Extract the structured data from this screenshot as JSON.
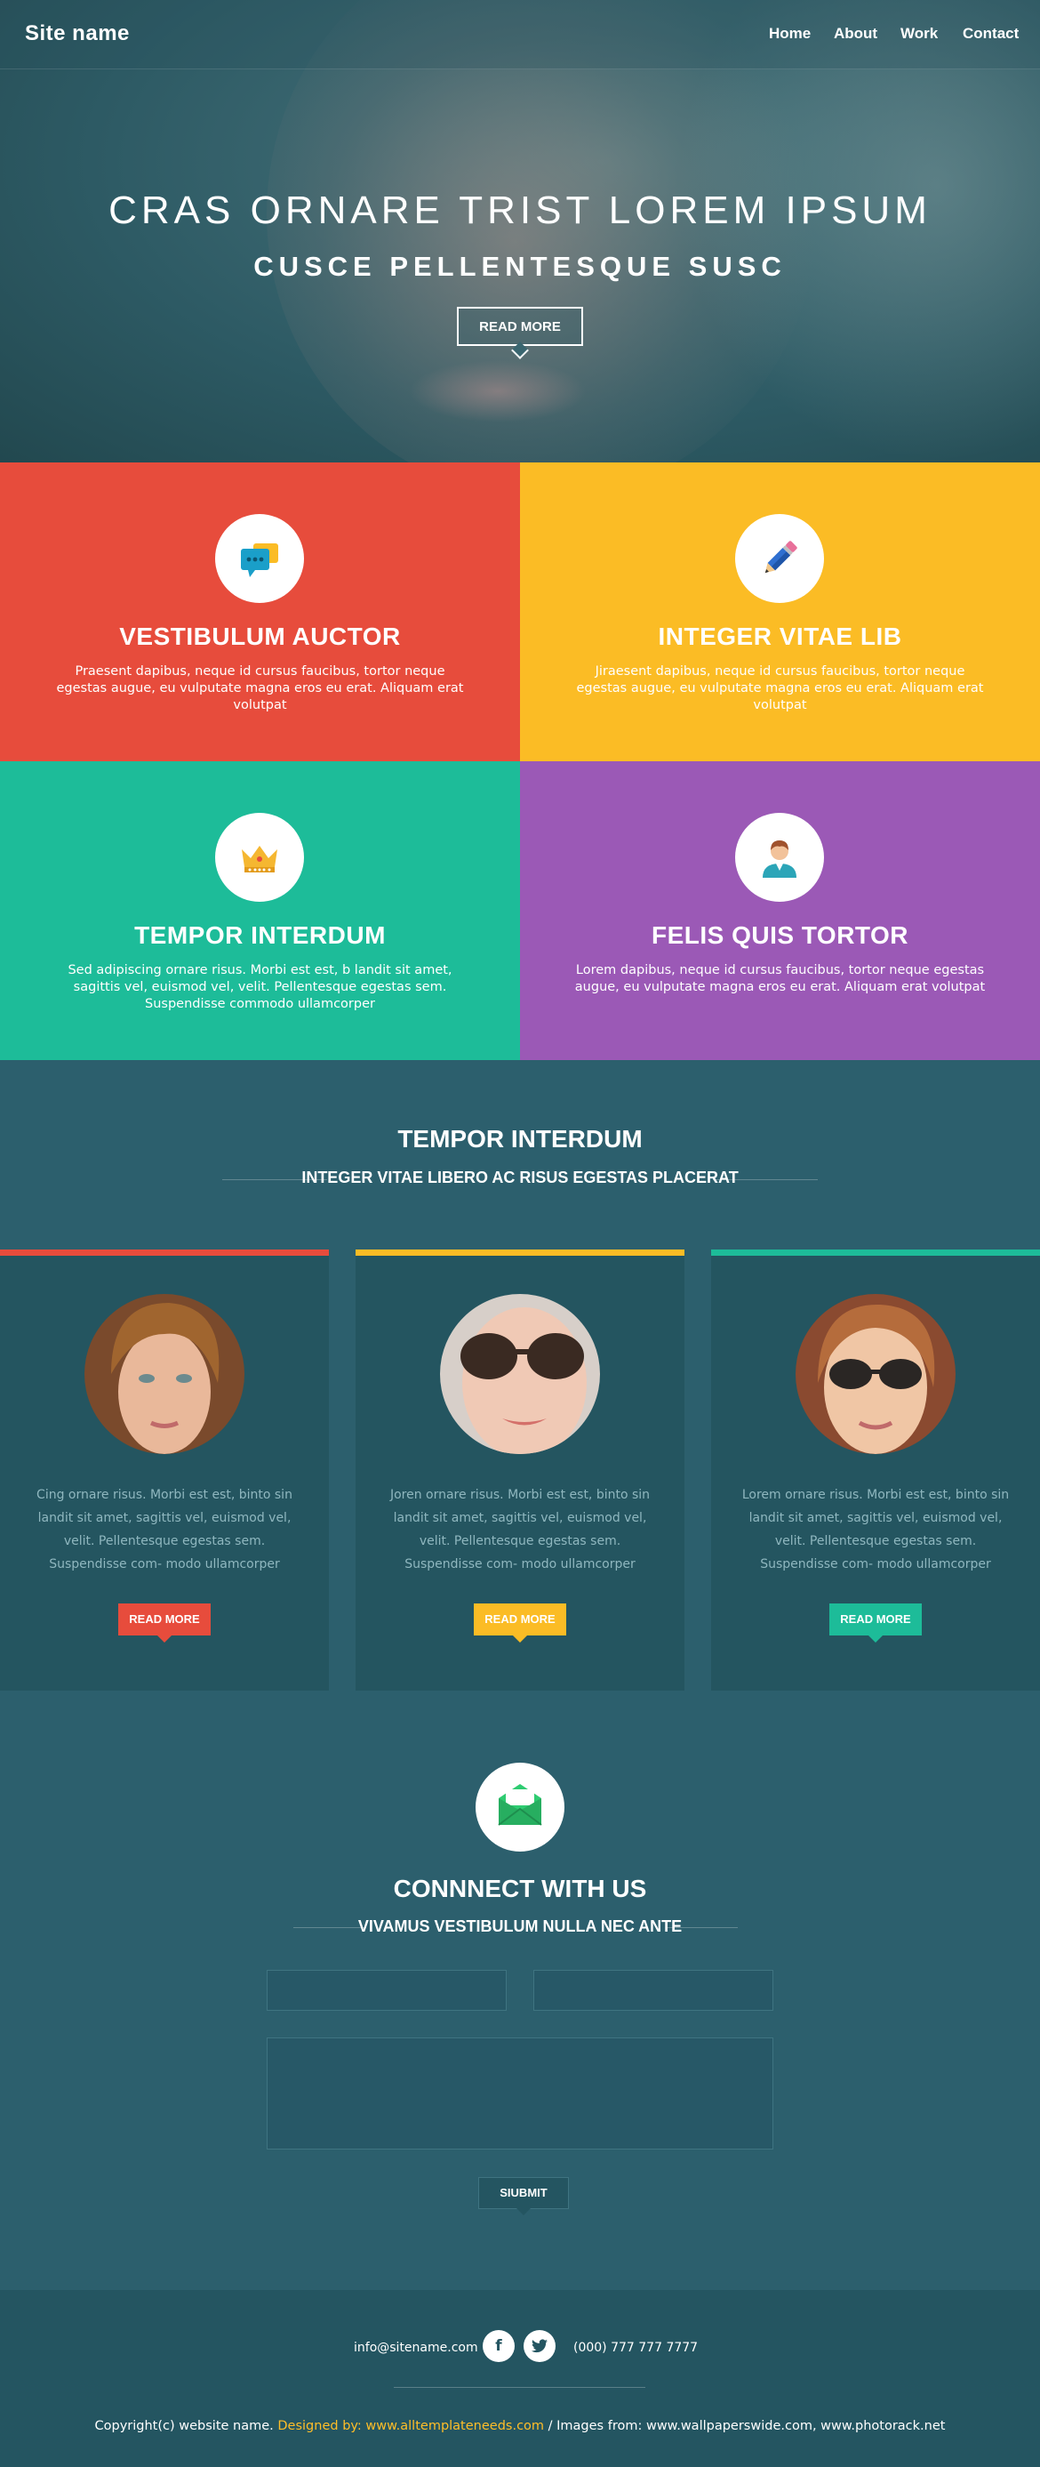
{
  "nav": {
    "site_name": "Site name",
    "links": [
      "Home",
      "About",
      "Work",
      "Contact"
    ]
  },
  "hero": {
    "title": "CRAS ORNARE TRIST LOREM IPSUM",
    "subtitle": "CUSCE PELLENTESQUE SUSC",
    "button": "READ MORE"
  },
  "features": [
    {
      "title": "VESTIBULUM AUCTOR",
      "text": "Praesent dapibus, neque id cursus faucibus, tortor neque egestas augue, eu vulputate magna eros eu erat. Aliquam erat volutpat",
      "color": "#e74c3c",
      "icon": "chat-bubbles-icon"
    },
    {
      "title": "INTEGER VITAE LIB",
      "text": "Jiraesent dapibus, neque id cursus faucibus, tortor neque egestas augue, eu vulputate magna eros eu erat. Aliquam erat volutpat",
      "color": "#fbbc25",
      "icon": "pencil-icon"
    },
    {
      "title": "TEMPOR INTERDUM",
      "text": "Sed adipiscing ornare risus. Morbi est est, b landit sit amet, sagittis vel, euismod vel, velit. Pellentesque egestas sem. Suspendisse commodo ullamcorper",
      "color": "#1dbc99",
      "icon": "crown-icon"
    },
    {
      "title": "FELIS QUIS TORTOR",
      "text": "Lorem dapibus, neque id cursus faucibus, tortor neque egestas augue, eu vulputate magna eros eu erat. Aliquam erat volutpat",
      "color": "#9b59b6",
      "icon": "user-icon"
    }
  ],
  "team": {
    "title": "TEMPOR INTERDUM",
    "subtitle": "INTEGER VITAE LIBERO AC RISUS EGESTAS PLACERAT",
    "cards": [
      {
        "text": "Cing ornare risus. Morbi est est, binto sin landit sit amet, sagittis vel, euismod vel, velit. Pellentesque egestas sem. Suspendisse com- modo ullamcorper",
        "button": "READ MORE",
        "color": "#e74c3c"
      },
      {
        "text": "Joren ornare risus. Morbi est est, binto sin landit sit amet, sagittis vel, euismod vel, velit. Pellentesque egestas sem. Suspendisse com- modo ullamcorper",
        "button": "READ MORE",
        "color": "#fbbc25"
      },
      {
        "text": "Lorem ornare risus. Morbi est est, binto sin landit sit amet, sagittis vel, euismod vel, velit. Pellentesque egestas sem. Suspendisse com- modo ullamcorper",
        "button": "READ MORE",
        "color": "#1dbc99"
      }
    ]
  },
  "contact": {
    "title": "CONNNECT WITH US",
    "subtitle": "VIVAMUS VESTIBULUM NULLA NEC ANTE",
    "submit": "SIUBMIT"
  },
  "footer": {
    "email": "info@sitename.com",
    "phone": "(000) 777 777 7777",
    "copyright": "Copyright(c) website name.",
    "designed": "Designed by: www.alltemplateneeds.com",
    "images": "/ Images from: www.wallpaperswide.com, www.photorack.net"
  }
}
